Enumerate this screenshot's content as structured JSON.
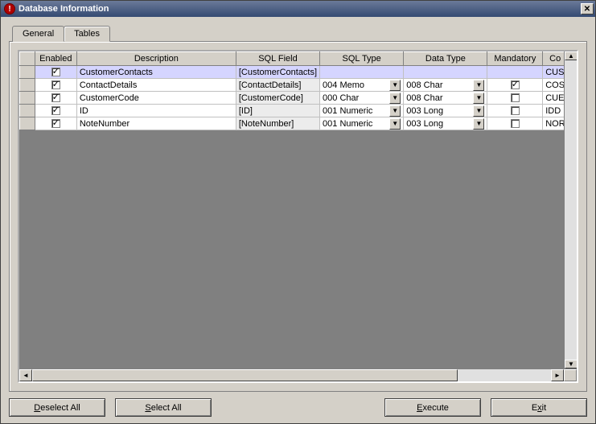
{
  "window": {
    "title": "Database Information"
  },
  "tabs": {
    "general": "General",
    "tables": "Tables",
    "active": "tables"
  },
  "columns": {
    "enabled": "Enabled",
    "description": "Description",
    "sqlfield": "SQL Field",
    "sqltype": "SQL Type",
    "datatype": "Data Type",
    "mandatory": "Mandatory",
    "code": "Co"
  },
  "rows": [
    {
      "enabled": true,
      "desc": "CustomerContacts",
      "sqlfield": "[CustomerContacts]",
      "sqltype": "",
      "datatype": "",
      "mandatory": false,
      "code": "CUS",
      "selected": true,
      "hasCombos": false
    },
    {
      "enabled": true,
      "desc": "ContactDetails",
      "sqlfield": "[ContactDetails]",
      "sqltype": "004 Memo",
      "datatype": "008 Char",
      "mandatory": true,
      "code": "COS",
      "selected": false,
      "hasCombos": true
    },
    {
      "enabled": true,
      "desc": "CustomerCode",
      "sqlfield": "[CustomerCode]",
      "sqltype": "000 Char",
      "datatype": "008 Char",
      "mandatory": false,
      "code": "CUE",
      "selected": false,
      "hasCombos": true
    },
    {
      "enabled": true,
      "desc": "ID",
      "sqlfield": "[ID]",
      "sqltype": "001 Numeric",
      "datatype": "003 Long",
      "mandatory": false,
      "code": "IDD",
      "selected": false,
      "hasCombos": true
    },
    {
      "enabled": true,
      "desc": "NoteNumber",
      "sqlfield": "[NoteNumber]",
      "sqltype": "001 Numeric",
      "datatype": "003 Long",
      "mandatory": false,
      "code": "NOR",
      "selected": false,
      "hasCombos": true
    }
  ],
  "buttons": {
    "deselect": "Deselect All",
    "select": "Select All",
    "execute": "Execute",
    "exit": "Exit"
  },
  "mnemonics": {
    "deselect": "D",
    "select": "S",
    "execute": "E",
    "exit": "x"
  }
}
